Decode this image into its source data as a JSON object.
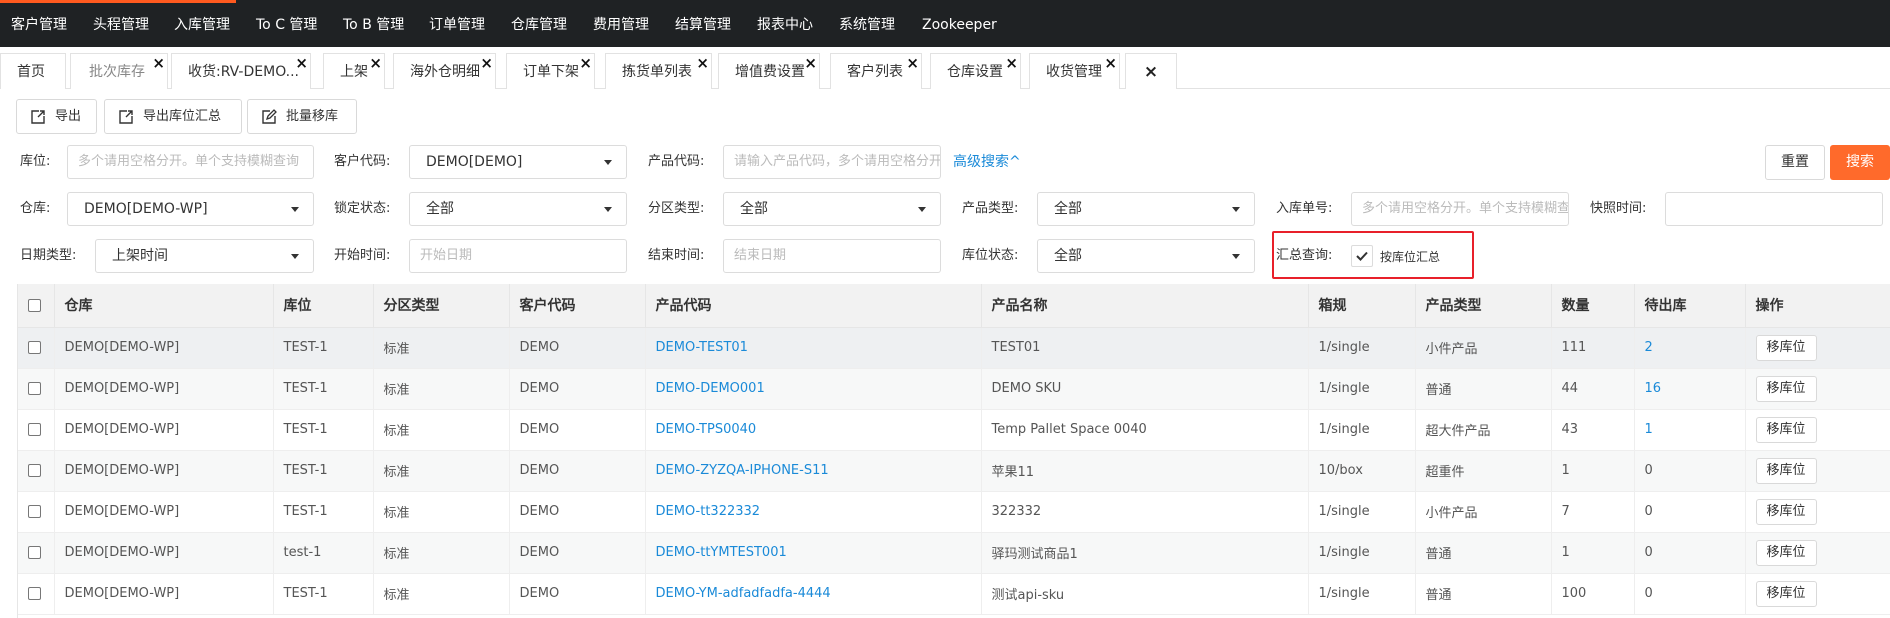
{
  "nav": {
    "items": [
      "客户管理",
      "头程管理",
      "入库管理",
      "To C 管理",
      "To B 管理",
      "订单管理",
      "仓库管理",
      "费用管理",
      "结算管理",
      "报表中心",
      "系统管理",
      "Zookeeper"
    ],
    "accent_color": "#ff5a1f"
  },
  "tabs": [
    {
      "label": "首页",
      "closable": false
    },
    {
      "label": "批次库存",
      "closable": true,
      "active": true
    },
    {
      "label": "收货:RV-DEMO...",
      "closable": true
    },
    {
      "label": "上架",
      "closable": true
    },
    {
      "label": "海外仓明细",
      "closable": true
    },
    {
      "label": "订单下架",
      "closable": true
    },
    {
      "label": "拣货单列表",
      "closable": true
    },
    {
      "label": "增值费设置",
      "closable": true
    },
    {
      "label": "客户列表",
      "closable": true
    },
    {
      "label": "仓库设置",
      "closable": true
    },
    {
      "label": "收货管理",
      "closable": true
    }
  ],
  "toolbar": {
    "export": "导出",
    "export_location_summary": "导出库位汇总",
    "batch_move": "批量移库"
  },
  "filters": {
    "location_label": "库位:",
    "location_placeholder": "多个请用空格分开。单个支持模糊查询",
    "customer_code_label": "客户代码:",
    "customer_code_value": "DEMO[DEMO]",
    "product_code_label": "产品代码:",
    "product_code_placeholder": "请输入产品代码，多个请用空格分开",
    "advanced_search": "高级搜索^",
    "reset": "重置",
    "search": "搜索",
    "warehouse_label": "仓库:",
    "warehouse_value": "DEMO[DEMO-WP]",
    "lock_status_label": "锁定状态:",
    "lock_status_value": "全部",
    "zone_type_label": "分区类型:",
    "zone_type_value": "全部",
    "product_type_label": "产品类型:",
    "product_type_value": "全部",
    "inbound_no_label": "入库单号:",
    "inbound_no_placeholder": "多个请用空格分开。单个支持模糊查询",
    "snapshot_time_label": "快照时间:",
    "date_type_label": "日期类型:",
    "date_type_value": "上架时间",
    "start_time_label": "开始时间:",
    "start_time_placeholder": "开始日期",
    "end_time_label": "结束时间:",
    "end_time_placeholder": "结束日期",
    "location_status_label": "库位状态:",
    "location_status_value": "全部",
    "summary_query_label": "汇总查询:",
    "summary_by_location": "按库位汇总",
    "summary_by_location_checked": true
  },
  "table": {
    "columns": [
      "仓库",
      "库位",
      "分区类型",
      "客户代码",
      "产品代码",
      "产品名称",
      "箱规",
      "产品类型",
      "数量",
      "待出库",
      "操作"
    ],
    "action_label": "移库位",
    "rows": [
      {
        "warehouse": "DEMO[DEMO-WP]",
        "location": "TEST-1",
        "zone": "标准",
        "customer": "DEMO",
        "sku": "DEMO-TEST01",
        "name": "TEST01",
        "spec": "1/single",
        "ptype": "小件产品",
        "qty": "111",
        "pending": "2"
      },
      {
        "warehouse": "DEMO[DEMO-WP]",
        "location": "TEST-1",
        "zone": "标准",
        "customer": "DEMO",
        "sku": "DEMO-DEMO001",
        "name": "DEMO SKU",
        "spec": "1/single",
        "ptype": "普通",
        "qty": "44",
        "pending": "16"
      },
      {
        "warehouse": "DEMO[DEMO-WP]",
        "location": "TEST-1",
        "zone": "标准",
        "customer": "DEMO",
        "sku": "DEMO-TPS0040",
        "name": "Temp Pallet Space 0040",
        "spec": "1/single",
        "ptype": "超大件产品",
        "qty": "43",
        "pending": "1"
      },
      {
        "warehouse": "DEMO[DEMO-WP]",
        "location": "TEST-1",
        "zone": "标准",
        "customer": "DEMO",
        "sku": "DEMO-ZYZQA-IPHONE-S11",
        "name": "苹果11",
        "spec": "10/box",
        "ptype": "超重件",
        "qty": "1",
        "pending": "0"
      },
      {
        "warehouse": "DEMO[DEMO-WP]",
        "location": "TEST-1",
        "zone": "标准",
        "customer": "DEMO",
        "sku": "DEMO-tt322332",
        "name": "322332",
        "spec": "1/single",
        "ptype": "小件产品",
        "qty": "7",
        "pending": "0"
      },
      {
        "warehouse": "DEMO[DEMO-WP]",
        "location": "test-1",
        "zone": "标准",
        "customer": "DEMO",
        "sku": "DEMO-ttYMTEST001",
        "name": "驿玛测试商品1",
        "spec": "1/single",
        "ptype": "普通",
        "qty": "1",
        "pending": "0"
      },
      {
        "warehouse": "DEMO[DEMO-WP]",
        "location": "TEST-1",
        "zone": "标准",
        "customer": "DEMO",
        "sku": "DEMO-YM-adfadfadfa-4444",
        "name": "测试api-sku",
        "spec": "1/single",
        "ptype": "普通",
        "qty": "100",
        "pending": "0"
      }
    ]
  }
}
